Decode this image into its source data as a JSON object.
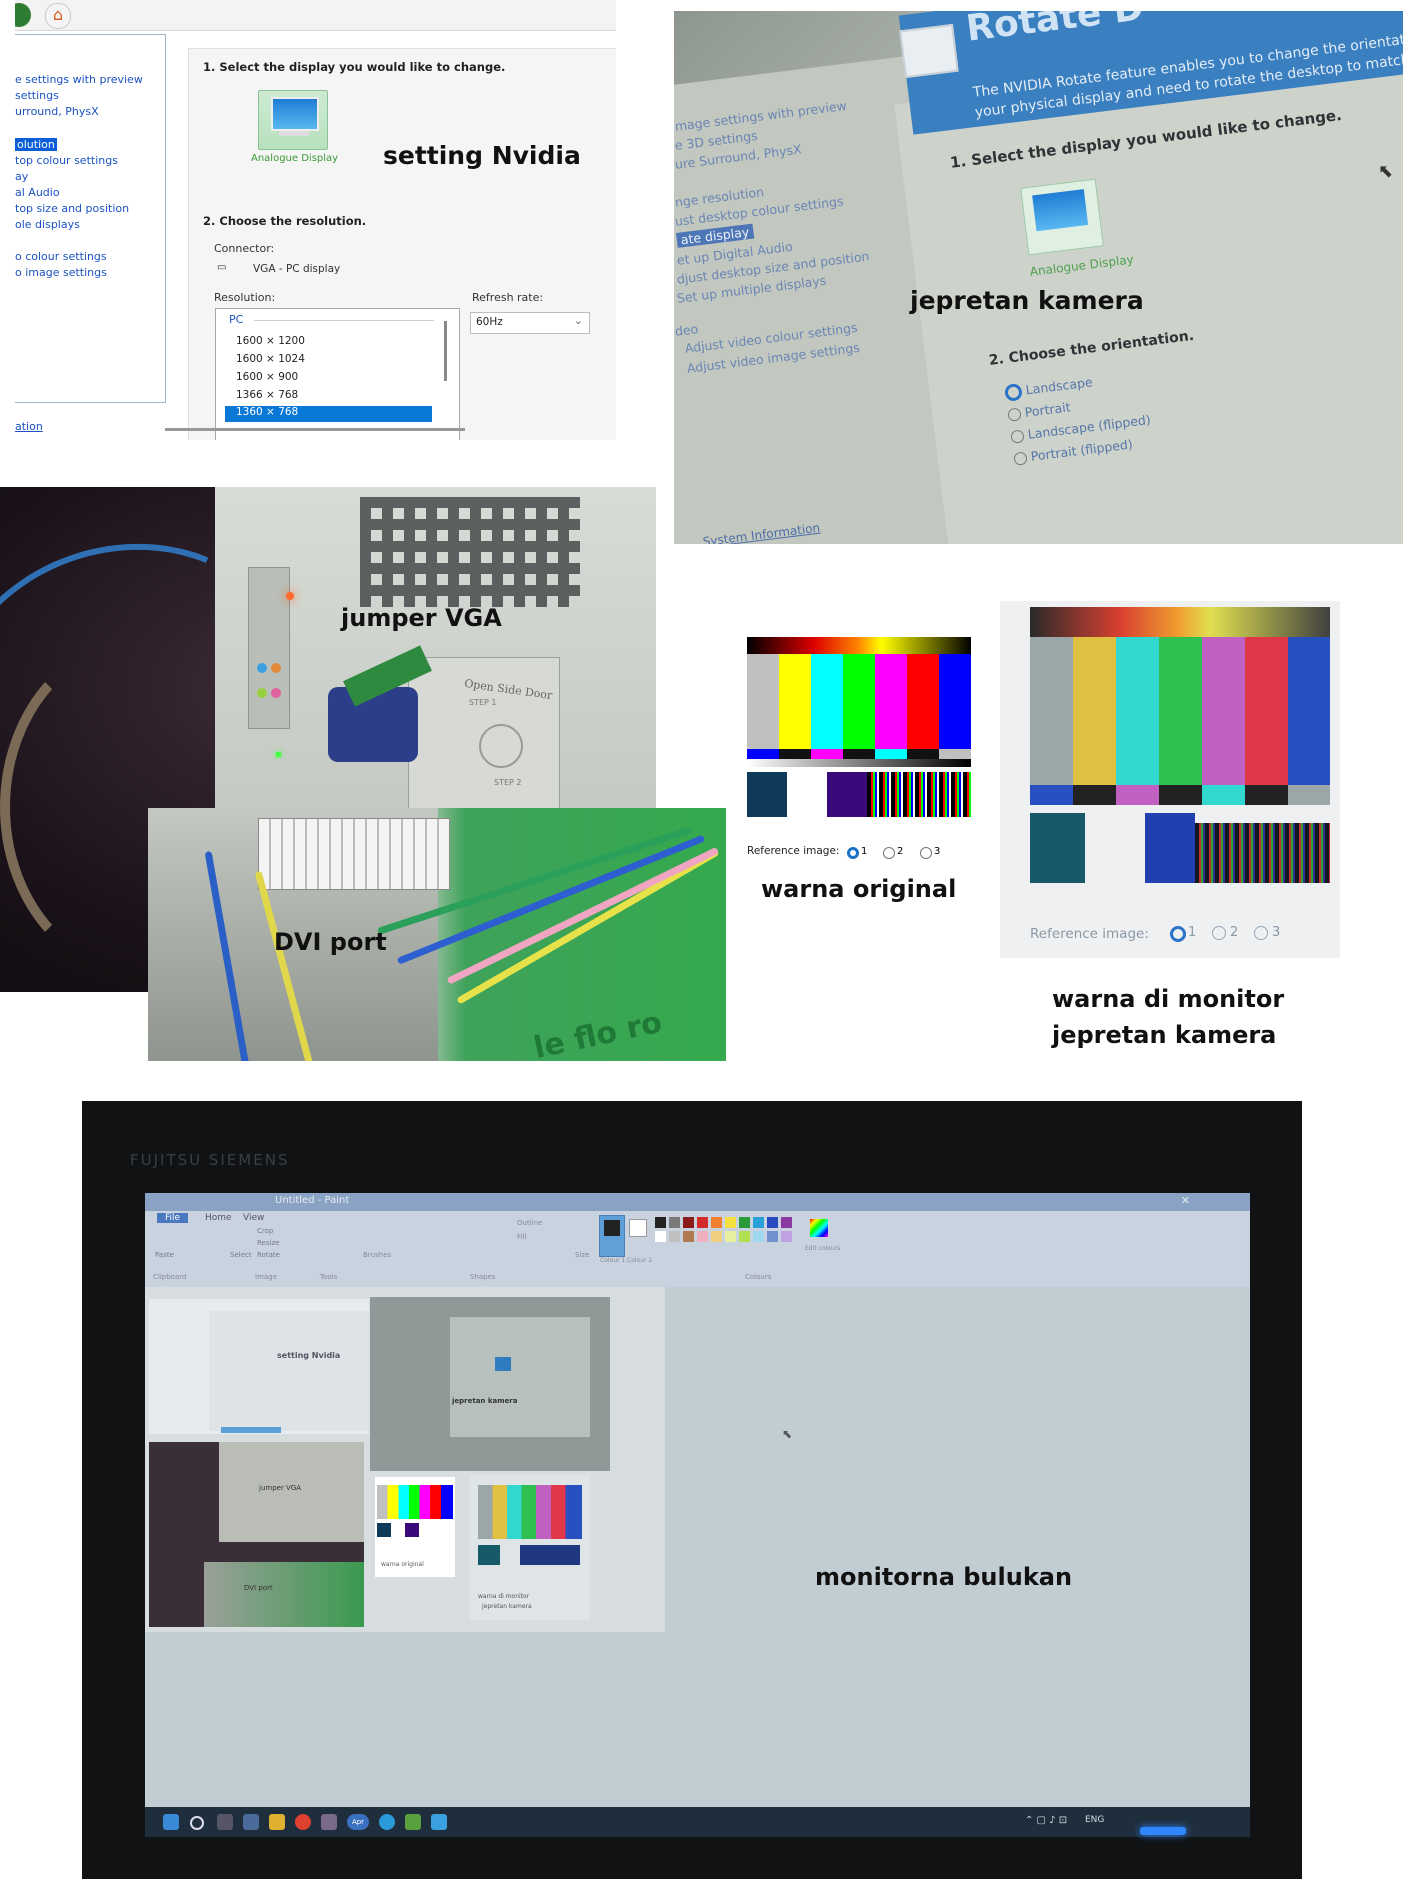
{
  "captions": {
    "setting_nvidia": "setting Nvidia",
    "jepretan_kamera": "jepretan kamera",
    "jumper_vga": "jumper VGA",
    "dvi_port": "DVI port",
    "warna_original": "warna original",
    "warna_di_monitor_line1": "warna di monitor",
    "warna_di_monitor_line2": "jepretan kamera",
    "monitorna_bulukan": "monitorna bulukan"
  },
  "nvidia_panel": {
    "nav_items": [
      "e settings with preview",
      "settings",
      "urround, PhysX",
      "olution",
      "top colour settings",
      "ay",
      "al Audio",
      "top size and position",
      "ole displays",
      "o colour settings",
      "o image settings"
    ],
    "nav_footer": "ation",
    "step1": "1. Select the display you would like to change.",
    "display_label": "Analogue Display",
    "step2": "2. Choose the resolution.",
    "connector_label": "Connector:",
    "connector_value": "VGA - PC display",
    "resolution_label": "Resolution:",
    "refresh_label": "Refresh rate:",
    "refresh_value": "60Hz",
    "list_group": "PC",
    "resolutions": [
      "1600 × 1200",
      "1600 × 1024",
      "1600 × 900",
      "1366 × 768",
      "1360 × 768"
    ],
    "selected_resolution": "1360 × 768"
  },
  "rotate_photo": {
    "header_title": "Rotate D",
    "desc_line1": "The NVIDIA Rotate feature enables you to change the orientation",
    "desc_line2": "your physical display and need to rotate the desktop to match the ori",
    "nav_items": [
      "mage settings with preview",
      "e 3D settings",
      "ure Surround, PhysX",
      "nge resolution",
      "ust desktop colour settings",
      "ate display",
      "et up Digital Audio",
      "djust desktop size and position",
      "Set up multiple displays",
      "deo",
      "Adjust video colour settings",
      "Adjust video image settings"
    ],
    "step1": "1. Select the display you would like to change.",
    "display_label": "Analogue Display",
    "step2": "2. Choose the orientation.",
    "orientations": [
      "Landscape",
      "Portrait",
      "Landscape (flipped)",
      "Portrait (flipped)"
    ],
    "system_info": "System Information"
  },
  "pc_case": {
    "door_label_line1": "Open Side Door",
    "door_label_line2": "STEP 1",
    "door_step2": "STEP 2"
  },
  "dvi_photo": {
    "board_text": "le flo ro"
  },
  "reference": {
    "label": "Reference image:",
    "options": [
      "1",
      "2",
      "3"
    ],
    "selected": "1",
    "colors": [
      "#c0c0c0",
      "#ffff00",
      "#00ffff",
      "#00ff00",
      "#ff00ff",
      "#ff0000",
      "#0000ff"
    ]
  },
  "monitor_photo": {
    "bezel_brand": "FUJITSU SIEMENS",
    "window_title": "Untitled - Paint",
    "tabs": [
      "File",
      "Home",
      "View"
    ],
    "ribbon_groups": [
      "Clipboard",
      "Image",
      "Tools",
      "Brushes",
      "Shapes",
      "Size",
      "Colour 1",
      "Colour 2",
      "Colours",
      "Edit colours"
    ],
    "shape_options": [
      "Outline",
      "Fill"
    ],
    "image_tools": [
      "Crop",
      "Resize",
      "Rotate"
    ],
    "select_label": "Select",
    "paste_label": "Paste",
    "tray_text": "ENG",
    "taskbar_badge": "Apr",
    "palette": [
      "#222222",
      "#7a7a7a",
      "#8b1a1a",
      "#d42a2a",
      "#f08030",
      "#f4e040",
      "#2a9a3a",
      "#2aa0d8",
      "#2a4ac0",
      "#8a3aa0",
      "#ffffff",
      "#c0c0c0",
      "#b07a50",
      "#f0b0c0",
      "#f0d080",
      "#e8f0a0",
      "#b0e050",
      "#a0d8f0",
      "#7090d0",
      "#c0a0e0"
    ]
  }
}
